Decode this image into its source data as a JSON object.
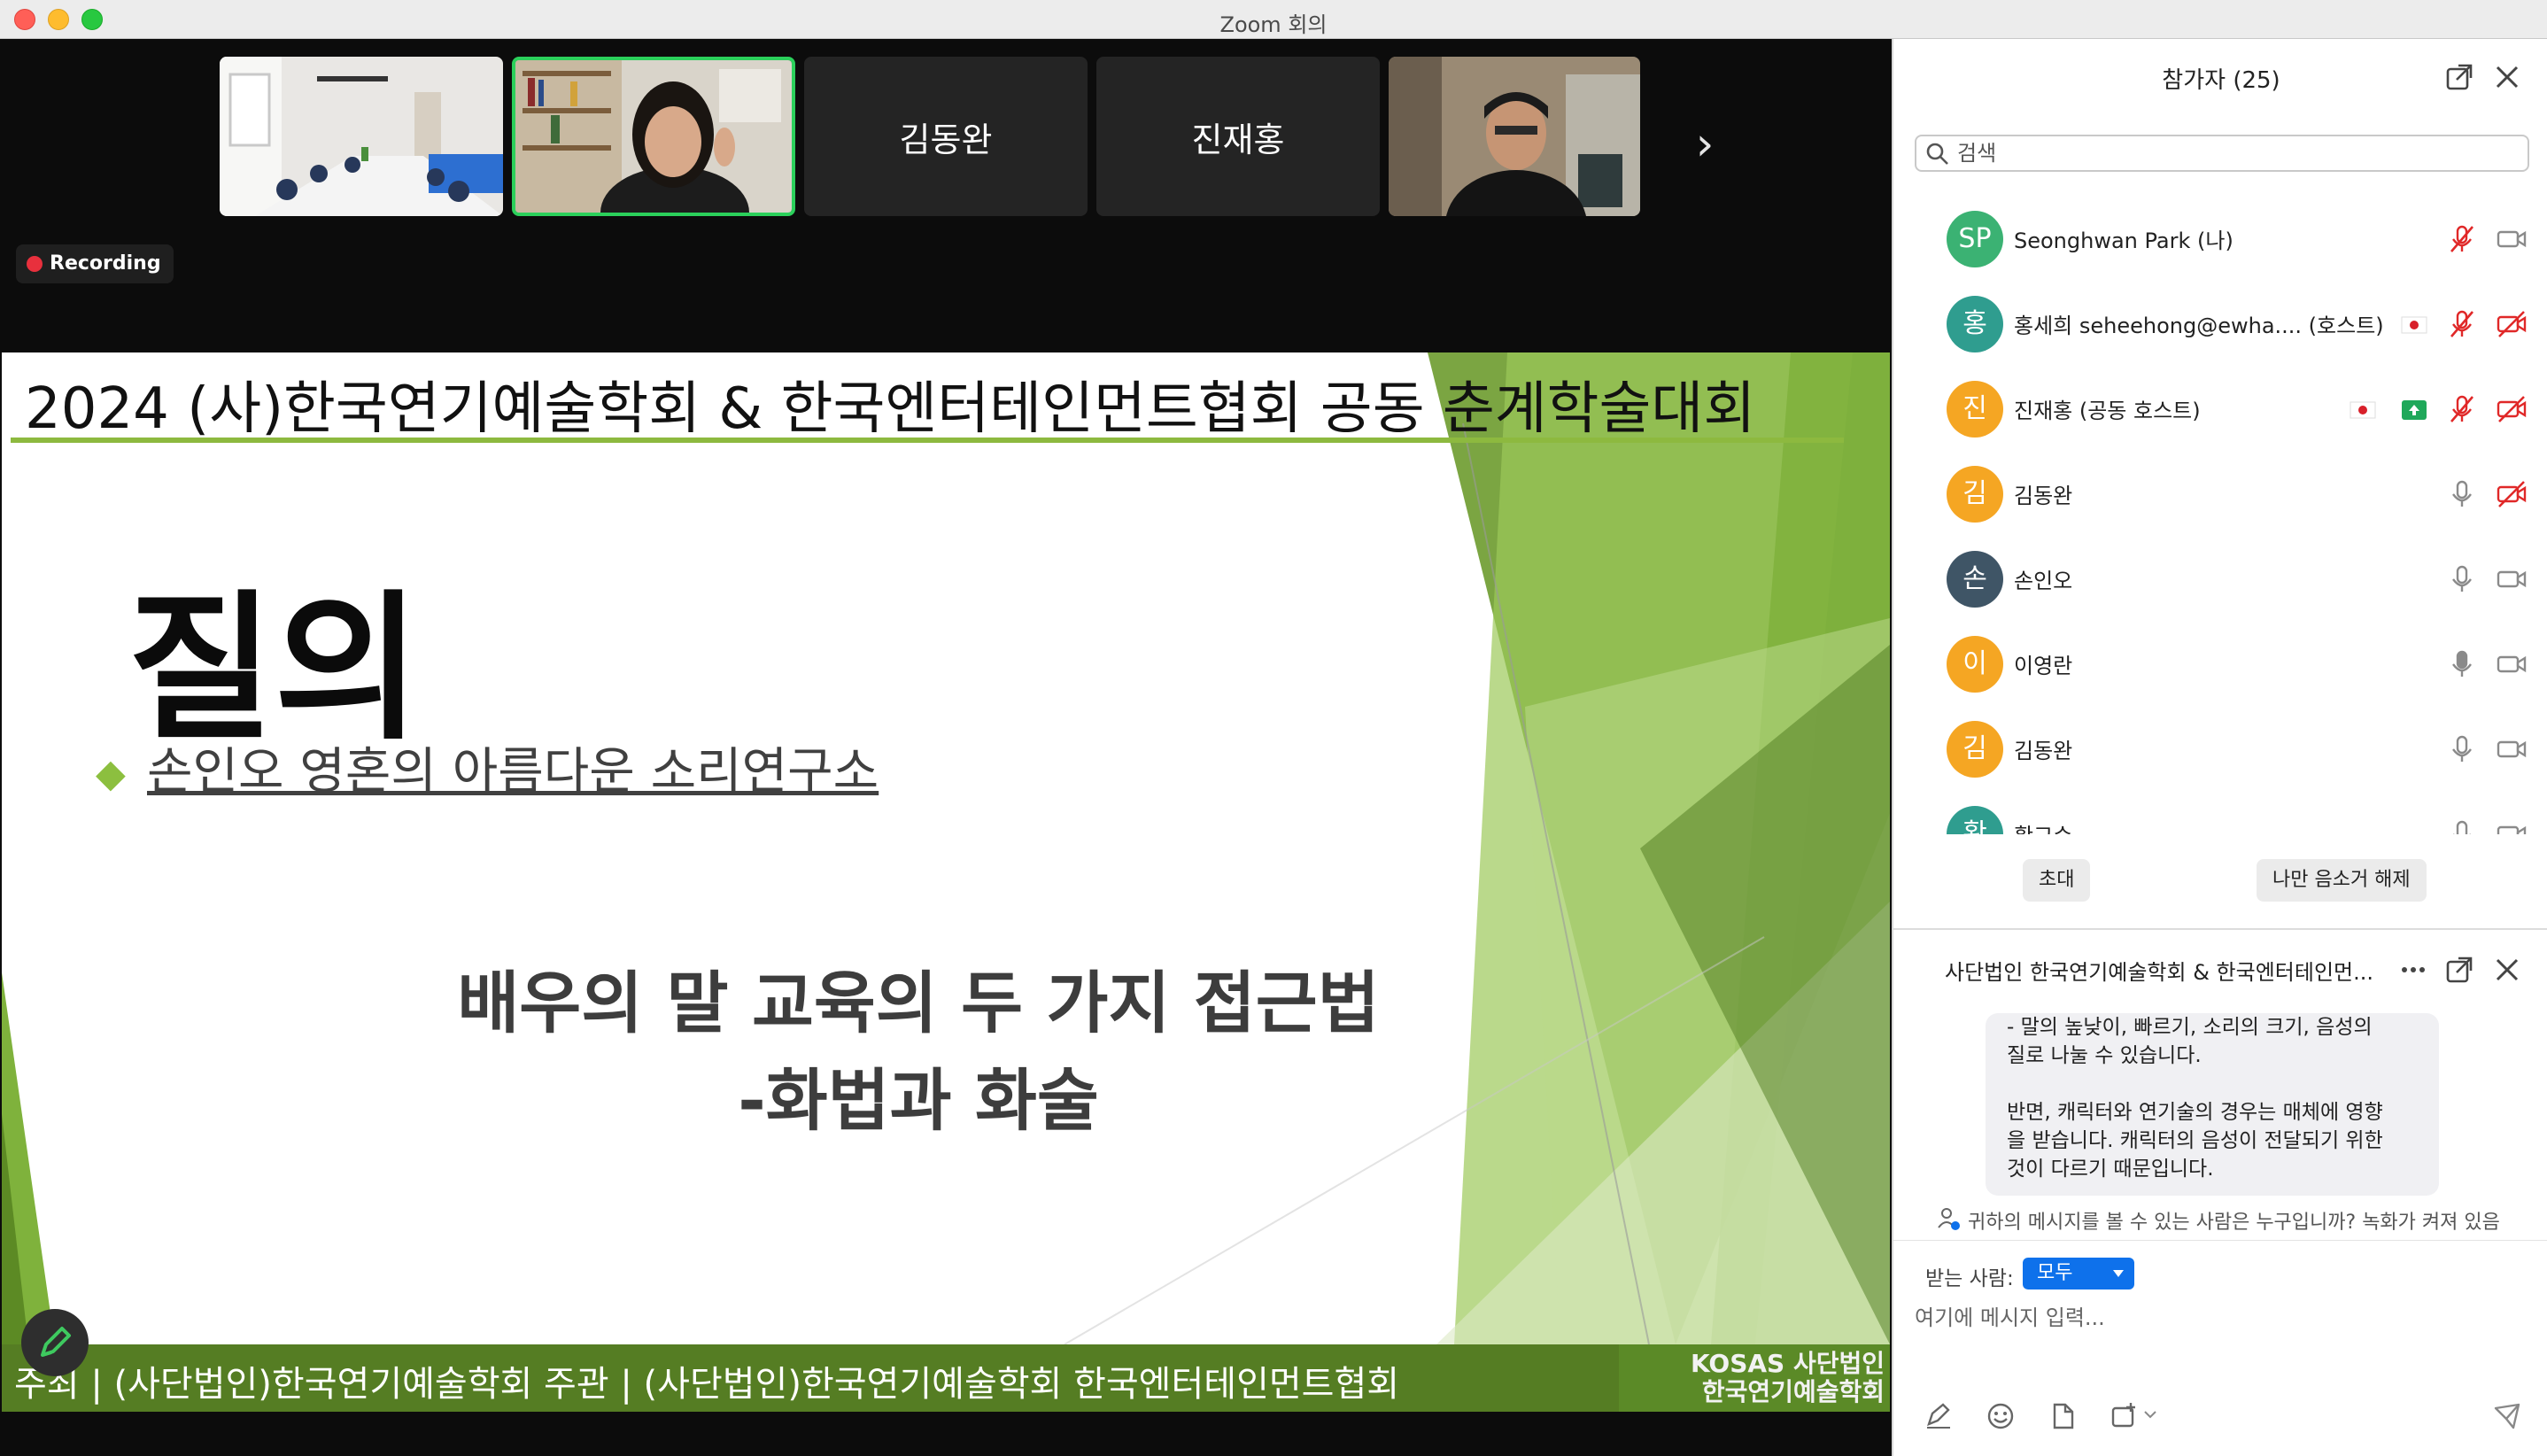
{
  "window": {
    "title": "Zoom 회의"
  },
  "meeting": {
    "thumbnails": [
      {
        "id": "room",
        "label": ""
      },
      {
        "id": "speaker",
        "label": ""
      },
      {
        "id": "dongwan",
        "label": "김동완"
      },
      {
        "id": "jaehong",
        "label": "진재홍"
      },
      {
        "id": "man",
        "label": ""
      }
    ],
    "next_label": "›",
    "recording_label": "Recording"
  },
  "slide": {
    "title": "2024 (사)한국연기예술학회 & 한국엔터테인먼트협회 공동 춘계학술대회",
    "heading": "질의",
    "bullet_mark": "◆",
    "bullet_text": "손인오 영혼의 아름다운 소리연구소",
    "body_line1": "배우의 말 교육의 두 가지 접근법",
    "body_line2": "-화법과 화술",
    "footer_text": "주최 | (사단법인)한국연기예술학회   주관 | (사단법인)한국연기예술학회   한국엔터테인먼트협회",
    "logo_line1": "KOSAS 사단법인",
    "logo_line2": "한국연기예술학회"
  },
  "panel": {
    "title": "참가자 (25)",
    "search_placeholder": "검색",
    "participants": [
      {
        "initial": "SP",
        "name": "Seonghwan Park (나)",
        "color": "#3bb273",
        "mic": "muted",
        "video": "on"
      },
      {
        "initial": "홍",
        "name": "홍세희 seheehong@ewha....  (호스트)",
        "color": "#2f9d8f",
        "mic": "muted",
        "video": "off",
        "flag": true
      },
      {
        "initial": "진",
        "name": "진재홍 (공동 호스트)",
        "color": "#f5a623",
        "mic": "muted",
        "video": "off",
        "flag": true,
        "share": true
      },
      {
        "initial": "김",
        "name": "김동완",
        "color": "#f5a623",
        "mic": "on",
        "video": "off"
      },
      {
        "initial": "손",
        "name": "손인오",
        "color": "#3f5566",
        "mic": "on",
        "video": "on"
      },
      {
        "initial": "이",
        "name": "이영란",
        "color": "#f5a623",
        "mic": "active",
        "video": "on"
      },
      {
        "initial": "김",
        "name": "김동완",
        "color": "#f5a623",
        "mic": "on",
        "video": "on"
      },
      {
        "initial": "황",
        "name": "황교수",
        "color": "#2f9d8f",
        "mic": "on",
        "video": "on"
      }
    ],
    "invite_label": "초대",
    "unmute_label": "나만 음소거 해제"
  },
  "chat": {
    "title": "사단법인 한국연기예술학회 & 한국엔터테인먼...",
    "message": "- 말의 높낮이, 빠르기, 소리의 크기, 음성의\n질로 나눌 수 있습니다.\n\n반면, 캐릭터와 연기술의 경우는 매체에 영향\n을 받습니다. 캐릭터의 음성이 전달되기 위한\n것이 다르기 때문입니다.",
    "privacy_note": "귀하의 메시지를 볼 수 있는 사람은 누구입니까? 녹화가 켜져 있음",
    "to_label": "받는 사람:",
    "to_value": "모두",
    "input_placeholder": "여기에 메시지 입력..."
  },
  "colors": {
    "accent_green": "#8db93f",
    "zoom_blue": "#0e71eb",
    "record_red": "#e8303d"
  }
}
